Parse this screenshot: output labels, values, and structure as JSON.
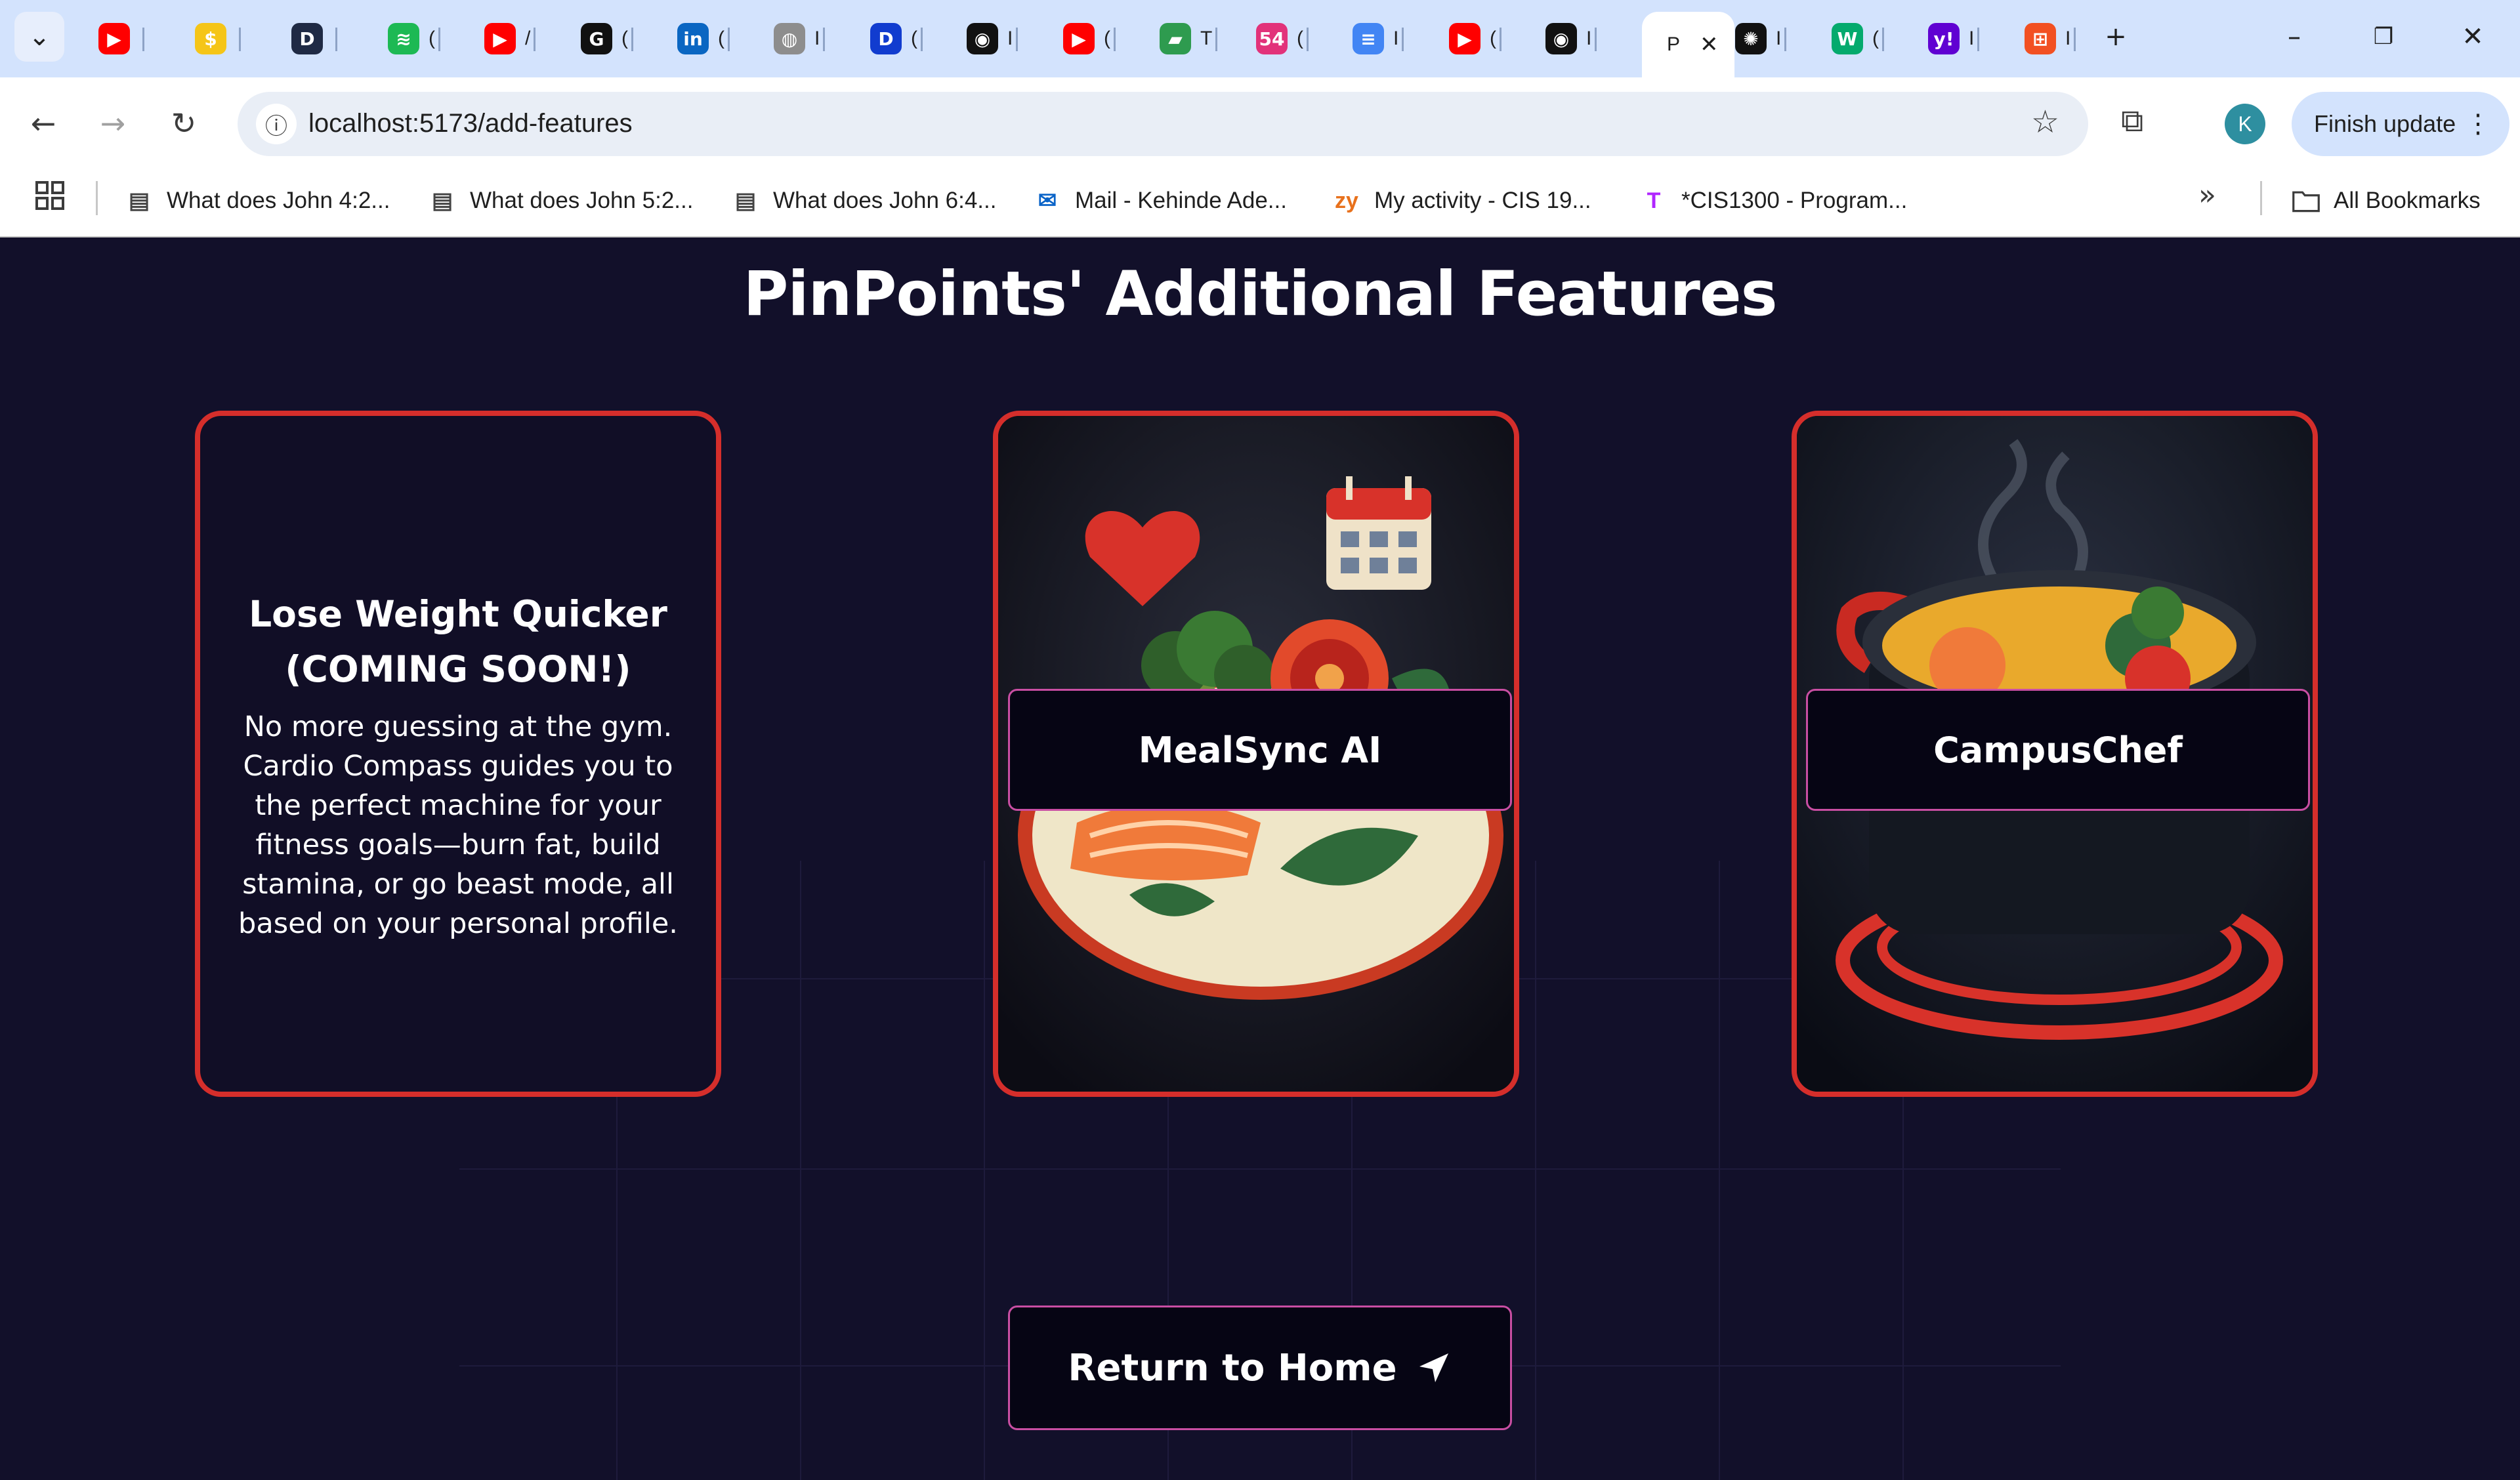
{
  "browser": {
    "tabs": [
      {
        "id": "youtube-1",
        "color": "#ff0000",
        "glyph": "▶"
      },
      {
        "id": "money",
        "color": "#f5c518",
        "glyph": "$"
      },
      {
        "id": "d",
        "color": "#1f2a44",
        "glyph": "D"
      },
      {
        "id": "spotify",
        "color": "#1db954",
        "glyph": "≋"
      },
      {
        "id": "youtube-2",
        "color": "#ff0000",
        "glyph": "▶"
      },
      {
        "id": "g",
        "color": "#111111",
        "glyph": "G"
      },
      {
        "id": "linkedin",
        "color": "#0a66c2",
        "glyph": "in"
      },
      {
        "id": "globe",
        "color": "#8d8d8d",
        "glyph": "◍"
      },
      {
        "id": "disney",
        "color": "#113ccf",
        "glyph": "D"
      },
      {
        "id": "github-1",
        "color": "#111111",
        "glyph": "◉"
      },
      {
        "id": "youtube-3",
        "color": "#ff0000",
        "glyph": "▶"
      },
      {
        "id": "book",
        "color": "#2e9b4f",
        "glyph": "▰"
      },
      {
        "id": "badge",
        "color": "#e2327a",
        "glyph": "54"
      },
      {
        "id": "docs",
        "color": "#4285f4",
        "glyph": "≡"
      },
      {
        "id": "youtube-4",
        "color": "#ff0000",
        "glyph": "▶"
      },
      {
        "id": "github-2",
        "color": "#111111",
        "glyph": "◉"
      },
      {
        "id": "active",
        "color": "#ffffff",
        "glyph": ""
      },
      {
        "id": "openai",
        "color": "#111111",
        "glyph": "✺"
      },
      {
        "id": "w3",
        "color": "#04aa6d",
        "glyph": "W"
      },
      {
        "id": "yahoo",
        "color": "#6001d2",
        "glyph": "y!"
      },
      {
        "id": "microsoft",
        "color": "#f25022",
        "glyph": "⊞"
      }
    ],
    "tab_title_fragments": [
      "",
      "",
      "",
      "(",
      "/",
      "(",
      "(",
      "I",
      "(",
      "I",
      "(",
      "T",
      "(",
      "I",
      "(",
      "I",
      "P",
      "I",
      "(",
      "I",
      "I"
    ],
    "url": "localhost:5173/add-features",
    "profile_initial": "K",
    "finish_update_label": "Finish update",
    "bookmarks": [
      {
        "label": "What does John 4:2...",
        "icon": "page-icon"
      },
      {
        "label": "What does John 5:2...",
        "icon": "page-icon"
      },
      {
        "label": "What does John 6:4...",
        "icon": "page-icon"
      },
      {
        "label": "Mail - Kehinde Ade...",
        "icon": "outlook-icon"
      },
      {
        "label": "My activity - CIS 19...",
        "icon": "zybooks-icon"
      },
      {
        "label": "*CIS1300 - Program...",
        "icon": "t-icon"
      }
    ],
    "all_bookmarks_label": "All Bookmarks"
  },
  "page": {
    "title": "PinPoints' Additional Features",
    "cards": [
      {
        "title_line1": "Lose Weight Quicker",
        "title_line2": "(COMING SOON!)",
        "description": "No more guessing at the gym. Cardio Compass guides you to the perfect machine for your fitness goals—burn fat, build stamina, or go beast mode, all based on your personal profile."
      },
      {
        "label": "MealSync AI"
      },
      {
        "label": "CampusChef"
      }
    ],
    "return_button_label": "Return to Home"
  },
  "colors": {
    "background": "#12102a",
    "card_border": "#d52e2b",
    "button_border": "#c94ea3",
    "text": "#ffffff"
  }
}
